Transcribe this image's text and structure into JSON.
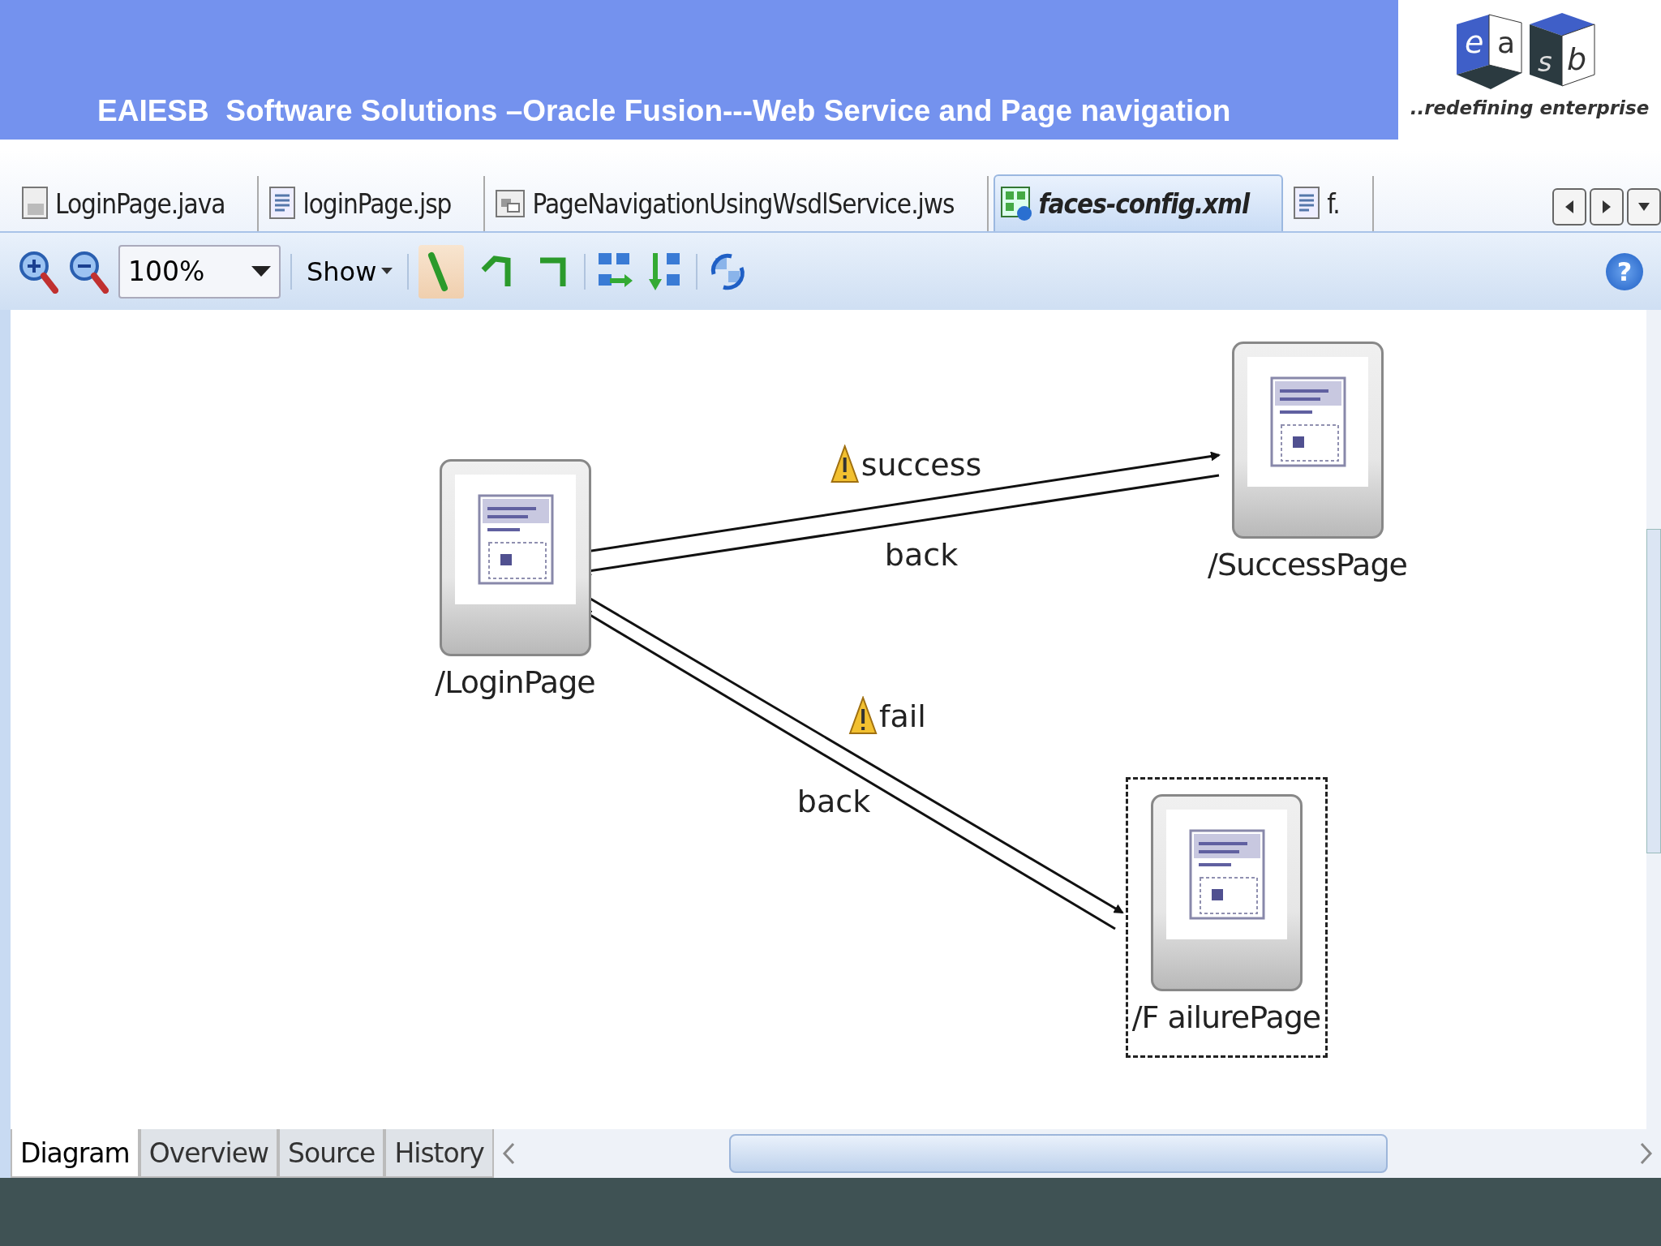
{
  "header": {
    "title": "EAIESB  Software Solutions –Oracle Fusion---Web Service and Page navigation",
    "logo_letters": [
      "e",
      "a",
      "s",
      "b"
    ],
    "tagline": "..redefining enterprise"
  },
  "tabs": [
    {
      "label": "LoginPage.java",
      "kind": "java",
      "selected": false
    },
    {
      "label": "loginPage.jsp",
      "kind": "jsp",
      "selected": false
    },
    {
      "label": "PageNavigationUsingWsdlService.jws",
      "kind": "jws",
      "selected": false
    },
    {
      "label": "faces-config.xml",
      "kind": "xml",
      "selected": true
    },
    {
      "label": "f.",
      "kind": "jsp",
      "selected": false
    }
  ],
  "toolbar": {
    "zoom": "100%",
    "show": "Show",
    "help": "?",
    "tools": [
      {
        "kind": "select",
        "selected": true
      },
      {
        "kind": "link",
        "selected": false
      },
      {
        "kind": "link2",
        "selected": false
      }
    ]
  },
  "diagram": {
    "nodes": [
      {
        "label": "/LoginPage",
        "selected": false
      },
      {
        "label": "/SuccessPage",
        "selected": false
      },
      {
        "label": "/F ailurePage",
        "selected": true
      }
    ],
    "edges": [
      {
        "label": "success",
        "warning": true
      },
      {
        "label": "back",
        "warning": false
      },
      {
        "label": "fail",
        "warning": true
      },
      {
        "label": "back",
        "warning": false
      }
    ]
  },
  "bottom_tabs": [
    {
      "label": "Diagram",
      "selected": true
    },
    {
      "label": "Overview",
      "selected": false
    },
    {
      "label": "Source",
      "selected": false
    },
    {
      "label": "History",
      "selected": false
    }
  ]
}
